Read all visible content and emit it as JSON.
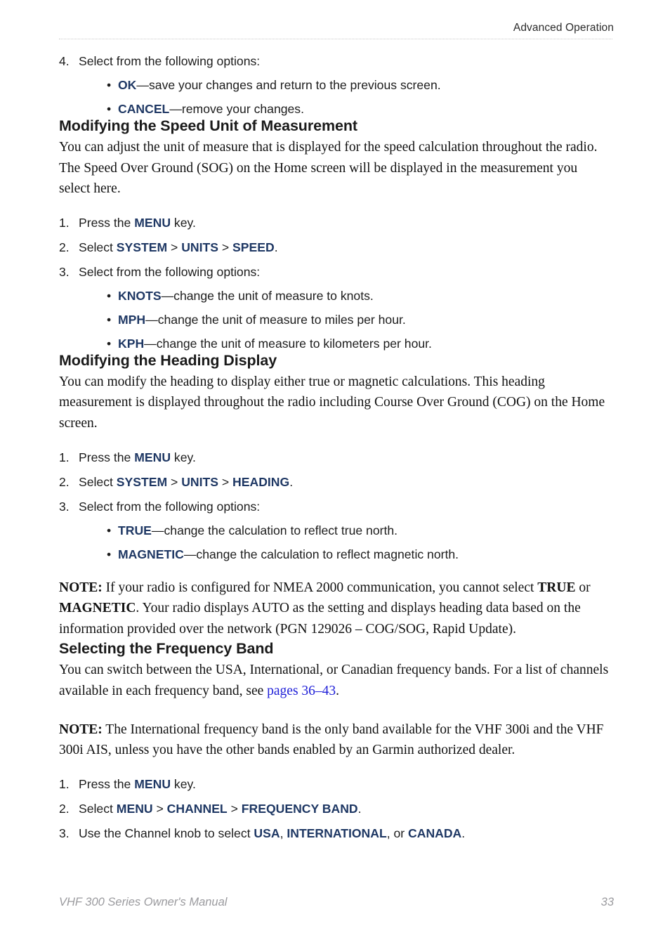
{
  "header": {
    "title": "Advanced Operation"
  },
  "footer": {
    "manual_title": "VHF 300 Series Owner's Manual",
    "page_number": "33"
  },
  "colors": {
    "ui_term_blue": "#1f3864",
    "cross_reference_blue": "#2020d8",
    "body_text": "#111111",
    "footer_gray": "#9a9a9e",
    "header_rule": "#c8c8c8"
  },
  "content": {
    "step4": {
      "number": "4.",
      "text": "Select from the following options:",
      "options": [
        {
          "bullet": "•",
          "term": "OK",
          "desc": "—save your changes and return to the previous screen."
        },
        {
          "bullet": "•",
          "term": "CANCEL",
          "desc": "—remove your changes."
        }
      ]
    },
    "speed_section": {
      "heading": "Modifying the Speed Unit of Measurement",
      "intro": "You can adjust the unit of measure that is displayed for the speed calculation throughout the radio. The Speed Over Ground (SOG) on the Home screen will be displayed in the measurement you select here.",
      "step1": {
        "number": "1.",
        "prefix": "Press the ",
        "term": "MENU",
        "suffix": " key."
      },
      "step2": {
        "number": "2.",
        "prefix": "Select ",
        "term1": "SYSTEM",
        "sep1": " > ",
        "term2": "UNITS",
        "sep2": " > ",
        "term3": "SPEED",
        "suffix": "."
      },
      "step3": {
        "number": "3.",
        "text": "Select from the following options:",
        "options": [
          {
            "bullet": "•",
            "term": "KNOTS",
            "desc": "—change the unit of measure to knots."
          },
          {
            "bullet": "•",
            "term": "MPH",
            "desc": "—change the unit of measure to miles per hour."
          },
          {
            "bullet": "•",
            "term": "KPH",
            "desc": "—change the unit of measure to kilometers per hour."
          }
        ]
      }
    },
    "heading_section": {
      "heading": "Modifying the Heading Display",
      "intro": "You can modify the heading to display either true or magnetic calculations. This heading measurement is displayed throughout the radio including Course Over Ground (COG) on the Home screen.",
      "step1": {
        "number": "1.",
        "prefix": "Press the ",
        "term": "MENU",
        "suffix": " key."
      },
      "step2": {
        "number": "2.",
        "prefix": "Select ",
        "term1": "SYSTEM",
        "sep1": " > ",
        "term2": "UNITS",
        "sep2": " > ",
        "term3": "HEADING",
        "suffix": "."
      },
      "step3": {
        "number": "3.",
        "text": "Select from the following options:",
        "options": [
          {
            "bullet": "•",
            "term": "TRUE",
            "desc": "—change the calculation to reflect true north."
          },
          {
            "bullet": "•",
            "term": "MAGNETIC",
            "desc": "—change the calculation to reflect magnetic north."
          }
        ]
      },
      "note": {
        "label": "NOTE:",
        "part1": " If your radio is configured for NMEA 2000 communication, you cannot select ",
        "term1": "TRUE",
        "part2": " or ",
        "term2": "MAGNETIC",
        "part3": ". Your radio displays AUTO as the setting and displays heading data based on the information provided over the network (PGN 129026 – COG/SOG, Rapid Update)."
      }
    },
    "frequency_section": {
      "heading": "Selecting the Frequency Band",
      "intro_part1": "You can switch between the USA, International, or Canadian frequency bands. For a list of channels available in each frequency band, see ",
      "intro_link": "pages 36–43",
      "intro_part2": ".",
      "note": {
        "label": "NOTE:",
        "text": " The International frequency band is the only band available for the VHF 300i and the VHF 300i AIS, unless you have the other bands enabled by an Garmin authorized dealer."
      },
      "step1": {
        "number": "1.",
        "prefix": "Press the ",
        "term": "MENU",
        "suffix": " key."
      },
      "step2": {
        "number": "2.",
        "prefix": "Select ",
        "term1": "MENU",
        "sep1": " > ",
        "term2": "CHANNEL",
        "sep2": " > ",
        "term3": "FREQUENCY BAND",
        "suffix": "."
      },
      "step3": {
        "number": "3.",
        "prefix": "Use the Channel knob to select ",
        "term1": "USA",
        "sep1": ", ",
        "term2": "INTERNATIONAL",
        "sep2": ", or ",
        "term3": "CANADA",
        "suffix": "."
      }
    }
  }
}
